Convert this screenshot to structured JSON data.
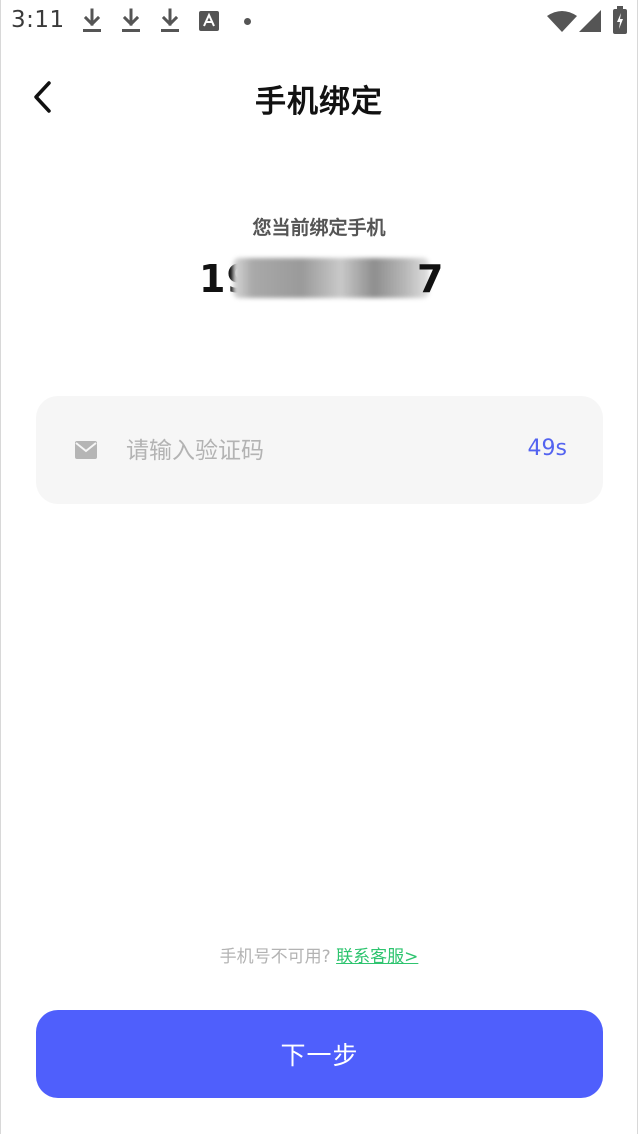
{
  "status_bar": {
    "time": "3:11",
    "notification_icons": [
      "download-icon",
      "download-icon",
      "download-icon",
      "a-box-icon",
      "dot-icon"
    ],
    "right_icons": [
      "wifi-icon",
      "signal-icon",
      "battery-icon"
    ]
  },
  "header": {
    "back_icon": "chevron-left-icon",
    "title": "手机绑定"
  },
  "current_phone": {
    "caption": "您当前绑定手机",
    "number_visible_prefix": "19",
    "number_visible_suffix": "7"
  },
  "code_field": {
    "icon": "mail-icon",
    "placeholder": "请输入验证码",
    "countdown": "49s"
  },
  "help": {
    "text": "手机号不可用?",
    "link_label": "联系客服>"
  },
  "footer": {
    "next_label": "下一步"
  },
  "colors": {
    "accent": "#4f5ffc",
    "countdown": "#5363f0",
    "link": "#2ec46f",
    "input_bg": "#f6f6f6"
  }
}
